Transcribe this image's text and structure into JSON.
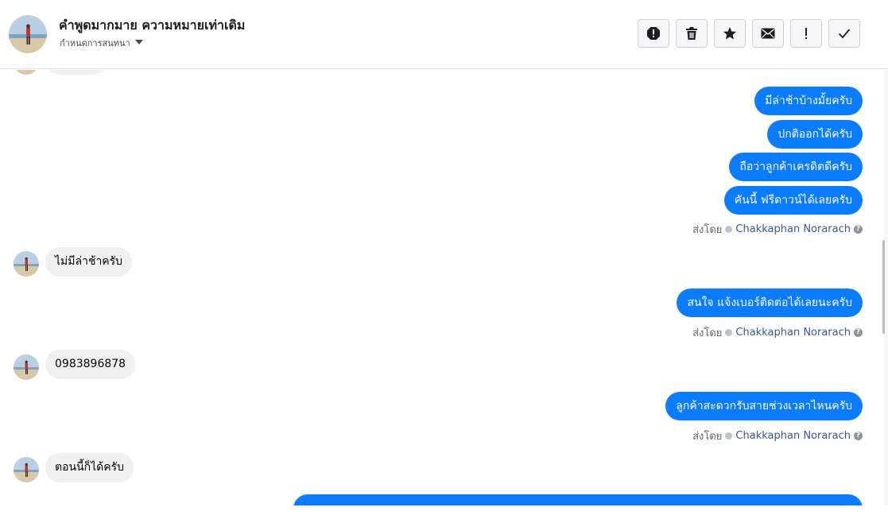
{
  "header": {
    "title": "คำพูดมากมาย ความหมายเท่าเดิม",
    "subtitle": "กำหนดการสนทนา"
  },
  "toolbar": {
    "buttons": [
      {
        "name": "report-spam-icon"
      },
      {
        "name": "trash-icon"
      },
      {
        "name": "star-icon"
      },
      {
        "name": "envelope-icon"
      },
      {
        "name": "exclamation-icon"
      },
      {
        "name": "checkmark-icon"
      }
    ]
  },
  "messages": {
    "out_1": "มีล่าช้าบ้างมั้ยครับ",
    "out_2": "ปกติออกได้ครับ",
    "out_3": "ถือว่าลูกค้าเครดิตดีครับ",
    "out_4": "คันนี้ ฟรีดาวน์ได้เลยครับ",
    "in_1": "ไม่มีล่าช้าครับ",
    "out_5": "สนใจ แจ้งเบอร์ติดต่อได้เลยนะครับ",
    "in_2": "0983896878",
    "out_6": "ลูกค้าสะดวกรับสายช่วงเวลาไหนครับ",
    "in_3": "ตอนนี้ก็ได้ครับ"
  },
  "sent_by": {
    "label": "ส่งโดย",
    "name": "Chakkaphan Norarach",
    "help": "?"
  },
  "colors": {
    "outgoing_bubble": "#0a7cff",
    "incoming_bubble": "#f0f0f0",
    "sender_name": "#385898"
  }
}
